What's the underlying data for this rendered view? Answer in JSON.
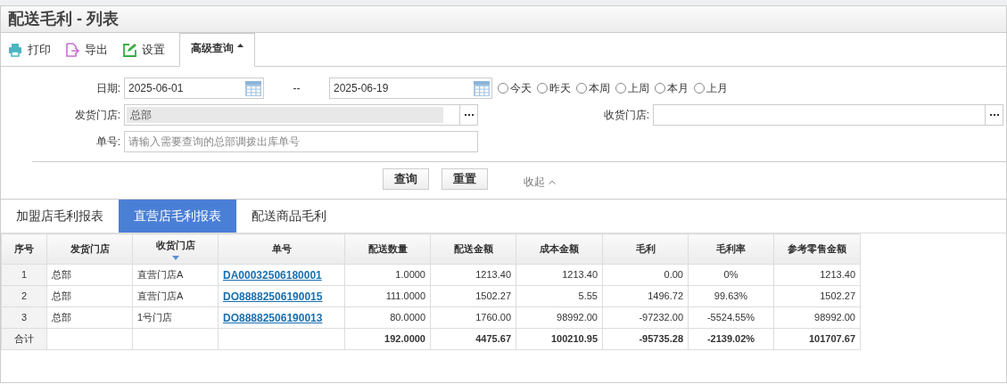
{
  "window": {
    "title": "配送毛利 - 列表"
  },
  "toolbar": [
    {
      "kind": "print",
      "label": "打印"
    },
    {
      "kind": "export",
      "label": "导出"
    },
    {
      "kind": "settings",
      "label": "设置"
    }
  ],
  "advanced_query": {
    "label": "高级查询",
    "expanded": true
  },
  "filters": {
    "date_label": "日期:",
    "date_from": "2025-06-01",
    "date_sep": "--",
    "date_to": "2025-06-19",
    "quick_ranges": [
      {
        "label": "今天",
        "selected": false
      },
      {
        "label": "昨天",
        "selected": false
      },
      {
        "label": "本周",
        "selected": false
      },
      {
        "label": "上周",
        "selected": false
      },
      {
        "label": "本月",
        "selected": false
      },
      {
        "label": "上月",
        "selected": false
      }
    ],
    "from_store_label": "发货门店:",
    "from_store": "总部",
    "to_store_label": "收货门店:",
    "order_no_label": "单号:",
    "order_no_placeholder": "请输入需要查询的总部调拨出库单号"
  },
  "buttons": [
    "查询",
    "重置"
  ],
  "collapse": "收起",
  "tabs": [
    {
      "label": "加盟店毛利报表",
      "selected": false
    },
    {
      "label": "直营店毛利报表",
      "selected": true
    },
    {
      "label": "配送商品毛利",
      "selected": false
    }
  ],
  "table": {
    "columns": [
      {
        "label": "序号",
        "sorted": false
      },
      {
        "label": "发货门店",
        "sorted": false
      },
      {
        "label": "收货门店",
        "sorted": true
      },
      {
        "label": "单号",
        "sorted": false
      },
      {
        "label": "配送数量",
        "sorted": false
      },
      {
        "label": "配送金额",
        "sorted": false
      },
      {
        "label": "成本金额",
        "sorted": false
      },
      {
        "label": "毛利",
        "sorted": false
      },
      {
        "label": "毛利率",
        "sorted": false
      },
      {
        "label": "参考零售金额",
        "sorted": false
      }
    ],
    "rows": [
      [
        "1",
        "总部",
        "直营门店A",
        "DA00032506180001",
        "1.0000",
        "1213.40",
        "1213.40",
        "0.00",
        "0%",
        "1213.40"
      ],
      [
        "2",
        "总部",
        "直营门店A",
        "DO88882506190015",
        "111.0000",
        "1502.27",
        "5.55",
        "1496.72",
        "99.63%",
        "1502.27"
      ],
      [
        "3",
        "总部",
        "1号门店",
        "DO88882506190013",
        "80.0000",
        "1760.00",
        "98992.00",
        "-97232.00",
        "-5524.55%",
        "98992.00"
      ]
    ],
    "totals": {
      "label": "合计",
      "values": [
        "192.0000",
        "4475.67",
        "100210.95",
        "-95735.28",
        "-2139.02%",
        "101707.67"
      ]
    }
  }
}
